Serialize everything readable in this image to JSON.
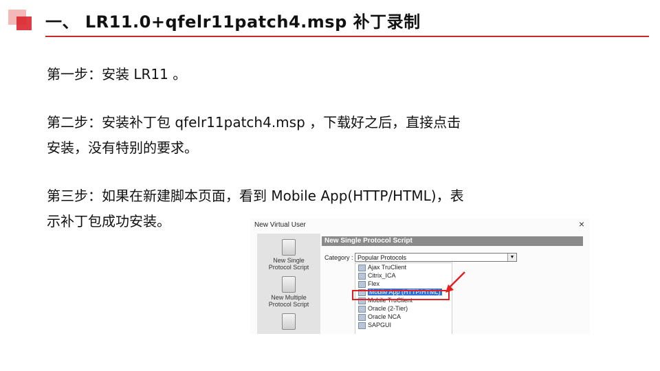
{
  "title": "一、 LR11.0+qfelr11patch4.msp 补丁录制",
  "steps": {
    "step1": "第一步：安装 LR11  。",
    "step2_line1": "第二步：安装补丁包 qfelr11patch4.msp ，下载好之后，直接点击",
    "step2_line2": "安装，没有特别的要求。",
    "step3_line1": "第三步：如果在新建脚本页面，看到 Mobile App(HTTP/HTML)，表",
    "step3_line2": "示补丁包成功安装。"
  },
  "dialog": {
    "window_title": "New Virtual User",
    "close_glyph": "×",
    "left_tools": [
      "New Single Protocol Script",
      "New Multiple Protocol Script"
    ],
    "section_header": "New Single Protocol Script",
    "category_label": "Category :",
    "category_value": "Popular Protocols",
    "protocols": [
      "Ajax TruClient",
      "Citrix_ICA",
      "Flex",
      "Mobile App (HTTP/HTML)",
      "Mobile TruClient",
      "Oracle (2-Tier)",
      "Oracle NCA",
      "SAPGUI"
    ],
    "selected_protocol": "Mobile App (HTTP/HTML)",
    "highlight_color": "#e02020"
  },
  "colors": {
    "accent": "#c62828",
    "logo_light": "#f3b8b8",
    "logo_dark": "#d9272e"
  }
}
